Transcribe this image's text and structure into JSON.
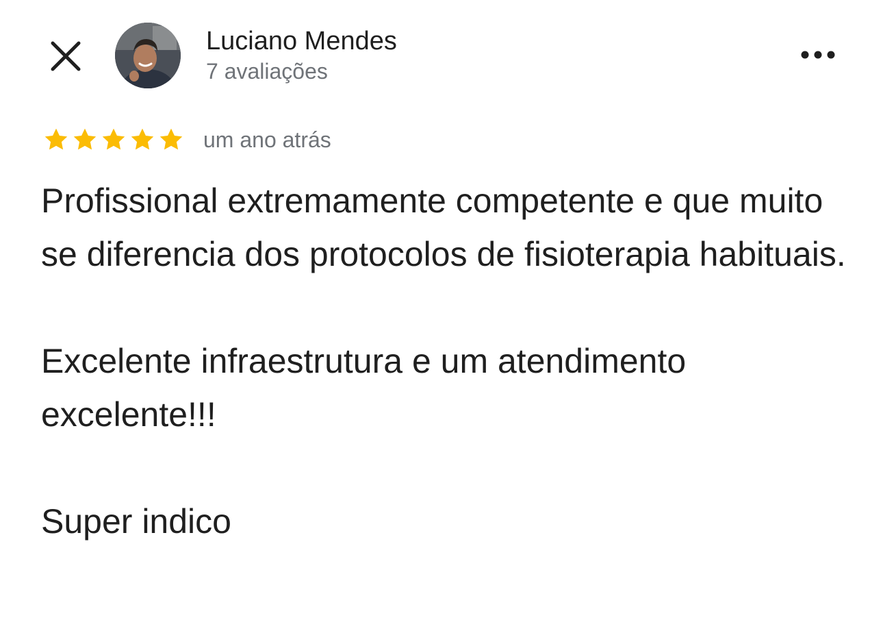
{
  "header": {
    "author_name": "Luciano Mendes",
    "review_count": "7 avaliações",
    "close_icon": "close-icon",
    "more_icon": "more-options-icon"
  },
  "rating": {
    "stars": 5,
    "max_stars": 5,
    "date": "um ano atrás",
    "star_color": "#fbbc04"
  },
  "review": {
    "paragraphs": [
      "Profissional extremamente competente e que muito se diferencia dos protocolos de fisioterapia habituais.",
      "Excelente infraestrutura e um atendimento excelente!!!",
      "Super indico"
    ]
  }
}
